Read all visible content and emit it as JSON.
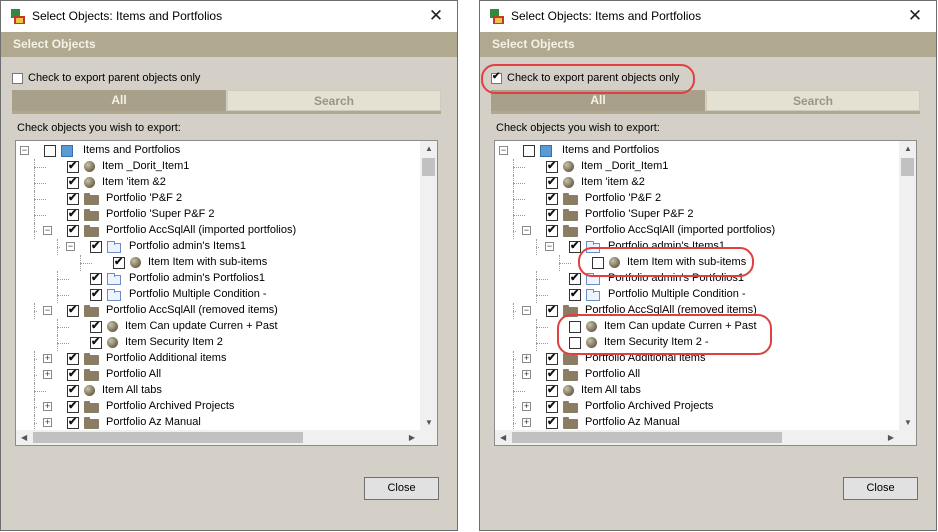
{
  "dialogs": [
    {
      "title": "Select Objects: Items and Portfolios",
      "header": "Select Objects",
      "parent_only": {
        "label": "Check to export parent objects only",
        "checked": false
      },
      "tabs": [
        {
          "label": "All",
          "active": true
        },
        {
          "label": "Search",
          "active": false
        }
      ],
      "instruction": "Check objects you wish to export:",
      "close_label": "Close",
      "tree": [
        {
          "label": "Items and Portfolios",
          "icon": "root",
          "checked": false,
          "expander": "minus"
        },
        {
          "label": "Item _Dorit_Item1",
          "icon": "item",
          "checked": true,
          "expander": ""
        },
        {
          "label": "Item 'item &2",
          "icon": "item",
          "checked": true,
          "expander": ""
        },
        {
          "label": "Portfolio 'P&F 2",
          "icon": "folder",
          "checked": true,
          "expander": ""
        },
        {
          "label": "Portfolio 'Super P&F 2",
          "icon": "folder",
          "checked": true,
          "expander": ""
        },
        {
          "label": "Portfolio AccSqlAll (imported portfolios)",
          "icon": "folder",
          "checked": true,
          "expander": "minus"
        },
        {
          "label": "Portfolio admin's Items1",
          "icon": "folder-blue",
          "checked": true,
          "expander": "minus"
        },
        {
          "label": "Item Item with sub-items",
          "icon": "item",
          "checked": true,
          "expander": ""
        },
        {
          "label": "Portfolio admin's Portfolios1",
          "icon": "folder-blue",
          "checked": true,
          "expander": ""
        },
        {
          "label": "Portfolio Multiple Condition -",
          "icon": "folder-blue",
          "checked": true,
          "expander": ""
        },
        {
          "label": "Portfolio AccSqlAll (removed items)",
          "icon": "folder",
          "checked": true,
          "expander": "minus"
        },
        {
          "label": "Item Can update Curren + Past",
          "icon": "item",
          "checked": true,
          "expander": ""
        },
        {
          "label": "Item Security Item 2",
          "icon": "item",
          "checked": true,
          "expander": ""
        },
        {
          "label": "Portfolio Additional items",
          "icon": "folder",
          "checked": true,
          "expander": "plus"
        },
        {
          "label": "Portfolio All",
          "icon": "folder",
          "checked": true,
          "expander": "plus"
        },
        {
          "label": "Item All tabs",
          "icon": "item",
          "checked": true,
          "expander": ""
        },
        {
          "label": "Portfolio Archived Projects",
          "icon": "folder",
          "checked": true,
          "expander": "plus"
        },
        {
          "label": "Portfolio Az Manual",
          "icon": "folder",
          "checked": true,
          "expander": "plus"
        }
      ]
    },
    {
      "title": "Select Objects: Items and Portfolios",
      "header": "Select Objects",
      "parent_only": {
        "label": "Check to export parent objects only",
        "checked": true
      },
      "tabs": [
        {
          "label": "All",
          "active": true
        },
        {
          "label": "Search",
          "active": false
        }
      ],
      "instruction": "Check objects you wish to export:",
      "close_label": "Close",
      "tree": [
        {
          "label": "Items and Portfolios",
          "icon": "root",
          "checked": false,
          "expander": "minus"
        },
        {
          "label": "Item _Dorit_Item1",
          "icon": "item",
          "checked": true,
          "expander": ""
        },
        {
          "label": "Item 'item &2",
          "icon": "item",
          "checked": true,
          "expander": ""
        },
        {
          "label": "Portfolio 'P&F 2",
          "icon": "folder",
          "checked": true,
          "expander": ""
        },
        {
          "label": "Portfolio 'Super P&F 2",
          "icon": "folder",
          "checked": true,
          "expander": ""
        },
        {
          "label": "Portfolio AccSqlAll (imported portfolios)",
          "icon": "folder",
          "checked": true,
          "expander": "minus"
        },
        {
          "label": "Portfolio admin's Items1",
          "icon": "folder-blue",
          "checked": true,
          "expander": "minus"
        },
        {
          "label": "Item Item with sub-items",
          "icon": "item",
          "checked": false,
          "expander": ""
        },
        {
          "label": "Portfolio admin's Portfolios1",
          "icon": "folder-blue",
          "checked": true,
          "expander": ""
        },
        {
          "label": "Portfolio Multiple Condition -",
          "icon": "folder-blue",
          "checked": true,
          "expander": ""
        },
        {
          "label": "Portfolio AccSqlAll (removed items)",
          "icon": "folder",
          "checked": true,
          "expander": "minus"
        },
        {
          "label": "Item Can update Curren + Past",
          "icon": "item",
          "checked": false,
          "expander": ""
        },
        {
          "label": "Item Security Item 2 -",
          "icon": "item",
          "checked": false,
          "expander": ""
        },
        {
          "label": "Portfolio Additional items",
          "icon": "folder",
          "checked": true,
          "expander": "plus"
        },
        {
          "label": "Portfolio All",
          "icon": "folder",
          "checked": true,
          "expander": "plus"
        },
        {
          "label": "Item All tabs",
          "icon": "item",
          "checked": true,
          "expander": ""
        },
        {
          "label": "Portfolio Archived Projects",
          "icon": "folder",
          "checked": true,
          "expander": "plus"
        },
        {
          "label": "Portfolio Az Manual",
          "icon": "folder",
          "checked": true,
          "expander": "plus"
        }
      ]
    }
  ],
  "icons": {
    "close": "close-icon",
    "app": "app-icon",
    "item": "item-icon",
    "folder": "folder-icon",
    "root": "root-icon"
  },
  "colors": {
    "header_bg": "#b0a88f",
    "tab_active": "#a8a08a",
    "callout": "#e04040"
  }
}
